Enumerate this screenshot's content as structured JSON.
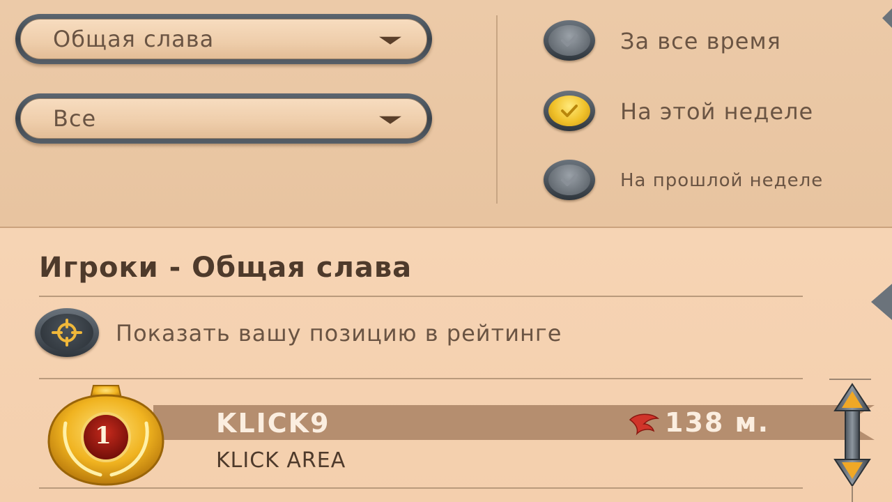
{
  "filters": {
    "category_dropdown": {
      "value": "Общая слава"
    },
    "scope_dropdown": {
      "value": "Все"
    }
  },
  "period": {
    "options": [
      {
        "label": "За все время",
        "checked": false
      },
      {
        "label": "На этой неделе",
        "checked": true
      },
      {
        "label": "На прошлой неделе",
        "checked": false
      }
    ]
  },
  "board": {
    "title": "Игроки - Общая слава",
    "show_position_label": "Показать вашу позицию в рейтинге",
    "rows": [
      {
        "rank": "1",
        "name": "KLICK9",
        "clan": "KLICK AREA",
        "fame": "138 м."
      }
    ]
  },
  "colors": {
    "panel_bg": "#eccaa8",
    "board_bg": "#f4cfad",
    "text": "#6a5443",
    "title": "#4e3a2b",
    "gold": "#f0c12a",
    "frame": "#3b434b"
  },
  "icons": {
    "dropdown": "chevron-down-icon",
    "radio_check": "check-icon",
    "show_position": "target-icon",
    "fame": "fame-icon",
    "rank_medal": "gold-medal-icon",
    "scroll": "scroll-arrows-icon"
  }
}
